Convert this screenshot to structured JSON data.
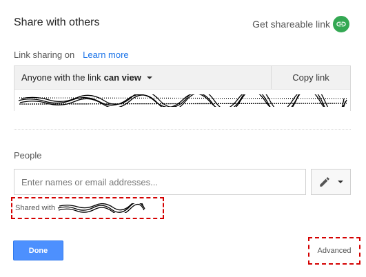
{
  "dialog": {
    "title": "Share with others",
    "get_link_label": "Get shareable link"
  },
  "link_sharing": {
    "label": "Link sharing on",
    "learn_more": "Learn more",
    "access_prefix": "Anyone with the link",
    "access_level": "can view",
    "copy_link": "Copy link"
  },
  "people": {
    "label": "People",
    "input_placeholder": "Enter names or email addresses...",
    "shared_with_label": "Shared with"
  },
  "footer": {
    "done": "Done",
    "advanced": "Advanced"
  },
  "colors": {
    "link_icon_bg": "#34a853",
    "learn_more": "#1a73e8",
    "done_bg": "#4d90fe",
    "annotation": "#d40000"
  },
  "icons": {
    "shareable_link": "link-icon",
    "permission": "pencil-icon",
    "dropdown": "caret-down-icon"
  }
}
